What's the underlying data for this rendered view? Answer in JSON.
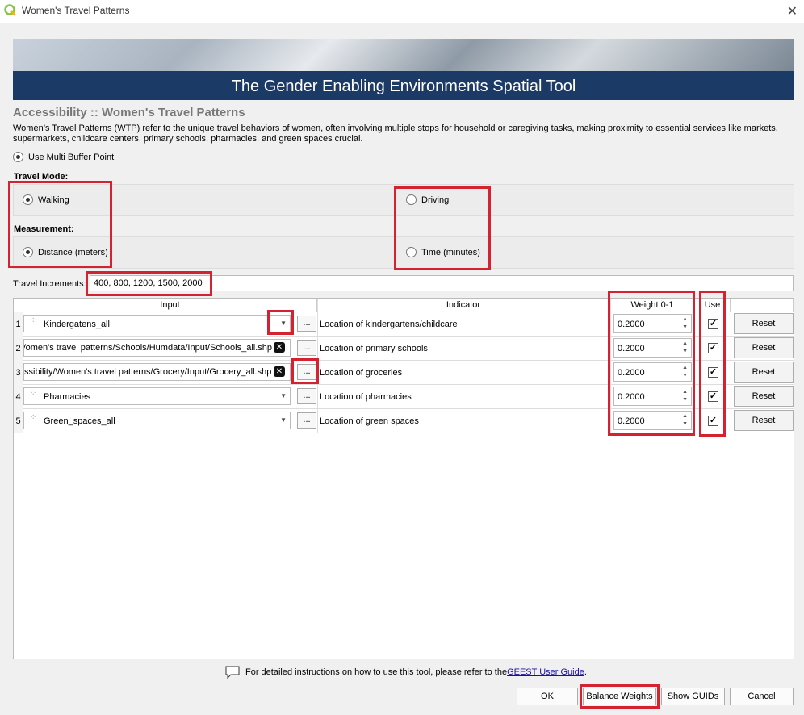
{
  "window": {
    "title": "Women's Travel Patterns",
    "close_icon": "close-icon"
  },
  "banner": {
    "title": "The Gender Enabling Environments Spatial Tool"
  },
  "section": {
    "title": "Accessibility :: Women's Travel Patterns",
    "description": "Women’s Travel Patterns (WTP) refer to the unique travel behaviors of women, often involving multiple stops for household or caregiving tasks, making proximity to essential services like markets, supermarkets, childcare centers, primary schools, pharmacies, and green spaces crucial."
  },
  "use_multi_buffer": {
    "label": "Use Multi Buffer Point",
    "checked": true
  },
  "travel_mode": {
    "label": "Travel Mode:",
    "options": [
      {
        "label": "Walking",
        "selected": true
      },
      {
        "label": "Driving",
        "selected": false
      }
    ]
  },
  "measurement": {
    "label": "Measurement:",
    "options": [
      {
        "label": "Distance (meters)",
        "selected": true
      },
      {
        "label": "Time (minutes)",
        "selected": false
      }
    ]
  },
  "travel_increments": {
    "label": "Travel Increments:",
    "value": "400, 800, 1200, 1500, 2000"
  },
  "table": {
    "headers": {
      "input": "Input",
      "indicator": "Indicator",
      "weight": "Weight 0-1",
      "use": "Use"
    },
    "rows": [
      {
        "num": "1",
        "input": "Kindergatens_all",
        "input_type": "combo",
        "browse": "...",
        "indicator": "Location of kindergartens/childcare",
        "weight": "0.2000",
        "use": true,
        "reset": "Reset"
      },
      {
        "num": "2",
        "input": "Vomen's travel patterns/Schools/Humdata/Input/Schools_all.shp",
        "input_type": "path",
        "browse": "...",
        "indicator": "Location of primary schools",
        "weight": "0.2000",
        "use": true,
        "reset": "Reset"
      },
      {
        "num": "3",
        "input": "ssibility/Women's travel patterns/Grocery/Input/Grocery_all.shp",
        "input_type": "path",
        "browse": "...",
        "indicator": "Location of groceries",
        "weight": "0.2000",
        "use": true,
        "reset": "Reset"
      },
      {
        "num": "4",
        "input": "Pharmacies",
        "input_type": "combo",
        "browse": "...",
        "indicator": "Location of pharmacies",
        "weight": "0.2000",
        "use": true,
        "reset": "Reset"
      },
      {
        "num": "5",
        "input": "Green_spaces_all",
        "input_type": "combo",
        "browse": "...",
        "indicator": "Location of green spaces",
        "weight": "0.2000",
        "use": true,
        "reset": "Reset"
      }
    ]
  },
  "footer": {
    "note_prefix": "For detailed instructions on how to use this tool, please refer to the ",
    "link": "GEEST User Guide",
    "note_suffix": ".",
    "buttons": {
      "ok": "OK",
      "balance": "Balance Weights",
      "guids": "Show GUIDs",
      "cancel": "Cancel"
    }
  },
  "colors": {
    "highlight": "#d42230",
    "banner_strip": "#1b3a66",
    "section_title": "#777777"
  }
}
